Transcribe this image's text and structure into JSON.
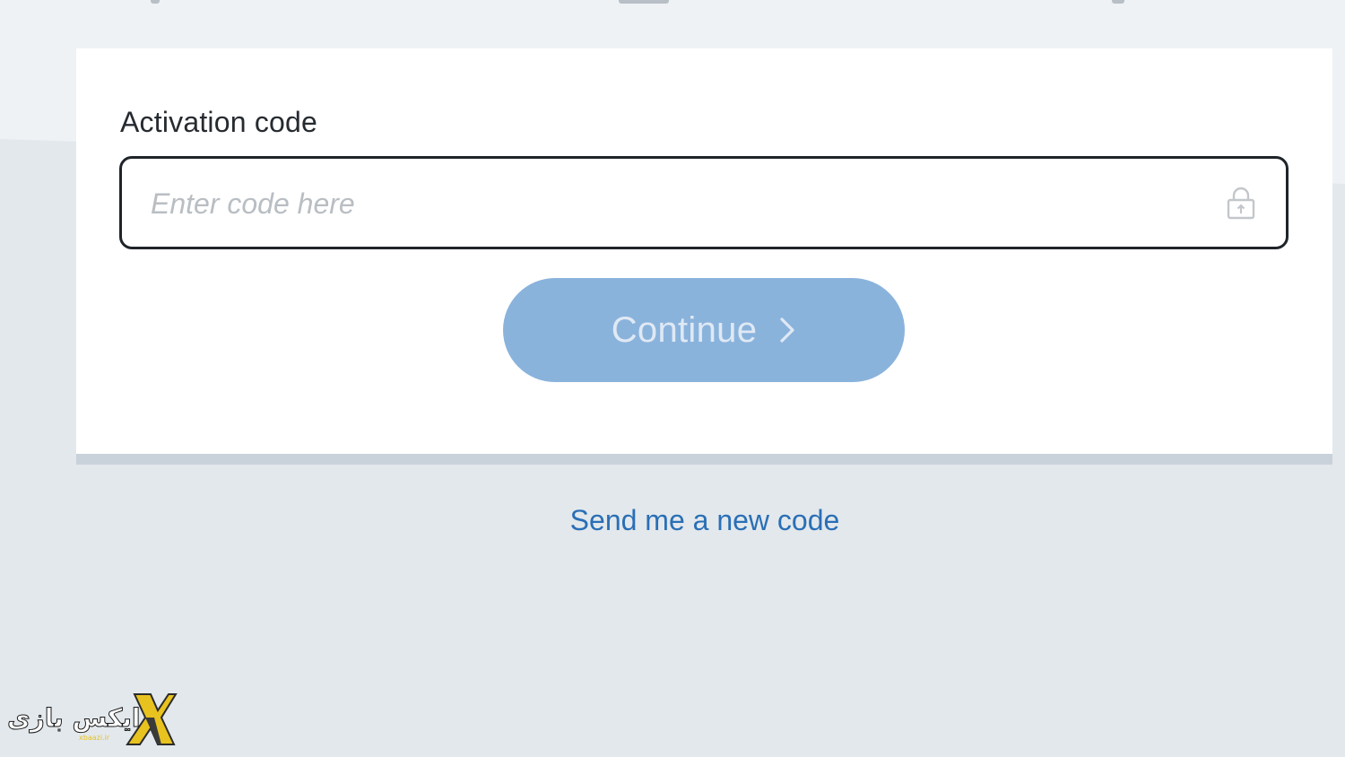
{
  "activation": {
    "label": "Activation code",
    "placeholder": "Enter code here",
    "value": ""
  },
  "continue_button": {
    "label": "Continue"
  },
  "resend_link": {
    "label": "Send me a new code"
  },
  "watermark": {
    "text": "ایکس بازی",
    "subtext": "xbaazi.ir"
  },
  "icons": {
    "field": "lock-icon",
    "button": "chevron-right-icon",
    "logo": "x-logo-icon"
  },
  "colors": {
    "accent": "#2a6fb6",
    "button_disabled": "#8ab3dc",
    "input_border": "#1f2429",
    "page_bg": "#e3e8ec"
  }
}
